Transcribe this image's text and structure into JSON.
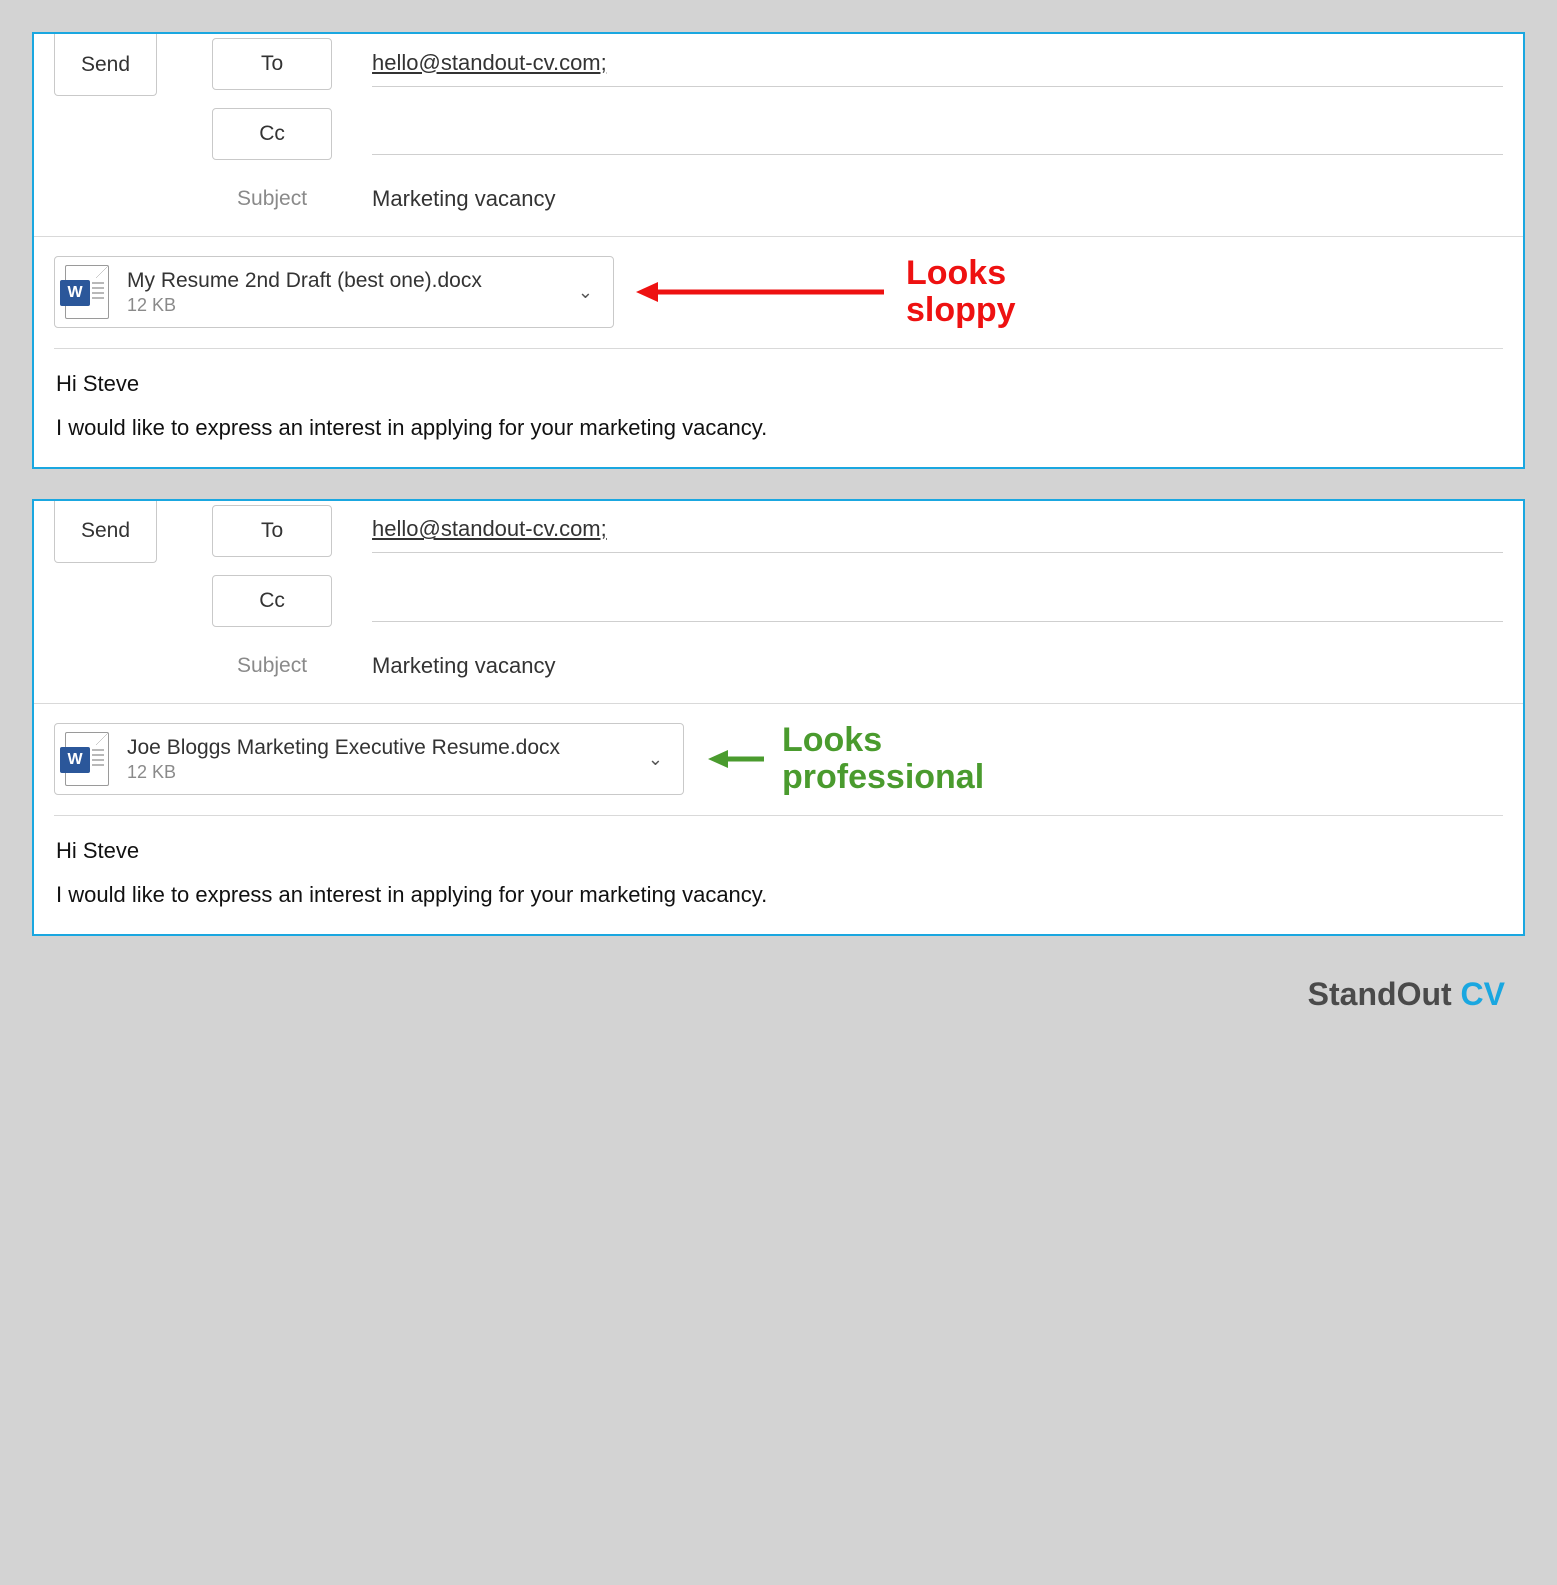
{
  "common": {
    "send_label": "Send",
    "to_label": "To",
    "cc_label": "Cc",
    "subject_label": "Subject",
    "to_value": "hello@standout-cv.com;",
    "cc_value": "",
    "subject_value": "Marketing vacancy",
    "word_glyph": "W",
    "chevron_glyph": "⌄"
  },
  "email1": {
    "attachment_name": "My Resume 2nd Draft (best one).docx",
    "attachment_size": "12 KB",
    "annotation_line1": "Looks",
    "annotation_line2": "sloppy",
    "body_greeting": "Hi Steve",
    "body_line": "I would like to express an interest in applying for your marketing vacancy."
  },
  "email2": {
    "attachment_name": "Joe Bloggs Marketing Executive Resume.docx",
    "attachment_size": "12 KB",
    "annotation_line1": "Looks",
    "annotation_line2": "professional",
    "body_greeting": "Hi Steve",
    "body_line": "I would like to express an interest in applying for your marketing vacancy."
  },
  "footer": {
    "brand1": "StandOut ",
    "brand2": "CV"
  },
  "colors": {
    "panel_border": "#1aa7e0",
    "red": "#e11",
    "green": "#4a9b2e",
    "word_blue": "#2b579a"
  }
}
